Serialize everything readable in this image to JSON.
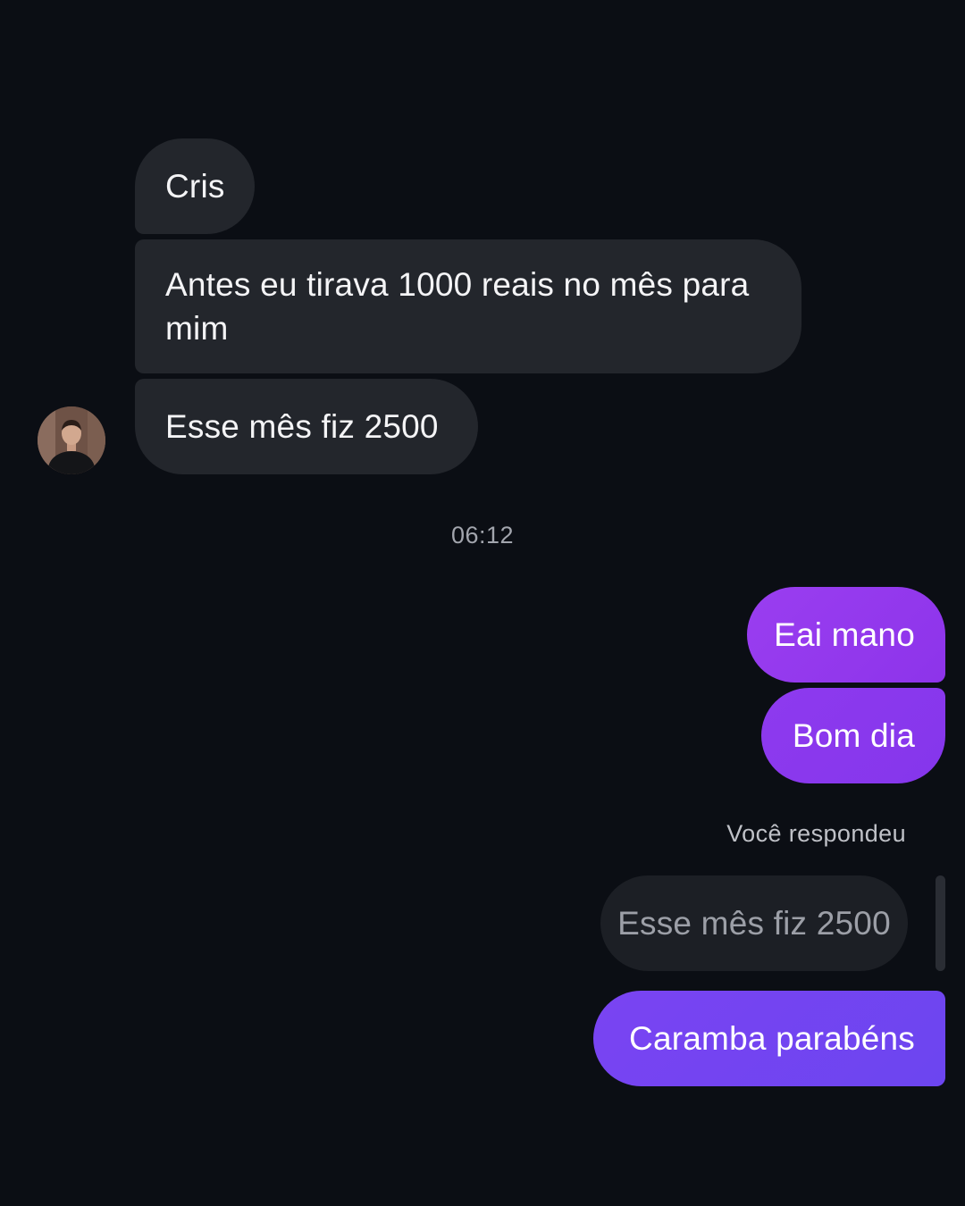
{
  "conversation": {
    "incoming_messages": [
      {
        "text": "Cris"
      },
      {
        "text": "Antes eu tirava 1000 reais no mês para mim"
      },
      {
        "text": "Esse mês fiz 2500"
      }
    ],
    "timestamp": "06:12",
    "outgoing_messages": [
      {
        "text": "Eai mano"
      },
      {
        "text": "Bom dia"
      }
    ],
    "reply": {
      "label": "Você respondeu",
      "quoted_text": "Esse mês fiz 2500",
      "message_text": "Caramba parabéns"
    }
  },
  "colors": {
    "background": "#0b0e14",
    "incoming_bubble": "#23262c",
    "outgoing_bubble_top": "#9a3ef0",
    "outgoing_bubble_bottom": "#6c45f0",
    "quoted_bubble": "#1c1f25"
  },
  "icons": {
    "sender_avatar": "user-photo-avatar"
  }
}
